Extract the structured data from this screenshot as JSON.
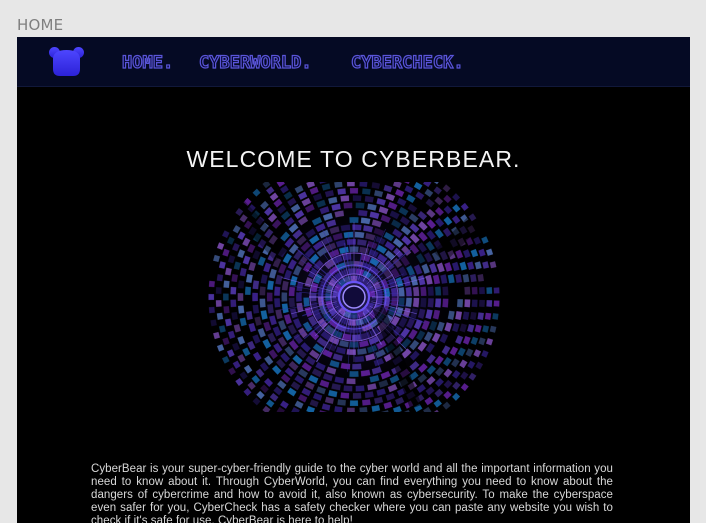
{
  "page": {
    "label": "HOME"
  },
  "nav": {
    "logo": "bear-icon",
    "items": [
      {
        "label": "HOME."
      },
      {
        "label": "CYBERWORLD."
      },
      {
        "label": "CYBERCHECK."
      }
    ]
  },
  "hero": {
    "title": "WELCOME TO CYBERBEAR.",
    "image": "cyber-tunnel-image"
  },
  "content": {
    "paragraph": "CyberBear is your super-cyber-friendly guide to the cyber world and all the important information you need to know about it. Through CyberWorld, you can find everything you need to know about the dangers of cybercrime and how to avoid it, also known as cybersecurity. To make the cyberspace even safer for you, CyberCheck has a safety checker where you can paste any website you wish to check if it's safe for use. CyberBear is here to help!"
  },
  "colors": {
    "page_background": "#e7e7e7",
    "frame_background": "#000000",
    "nav_background": "#050a24",
    "nav_accent": "#5a55d8",
    "hero_accent": "#6d56ff"
  }
}
